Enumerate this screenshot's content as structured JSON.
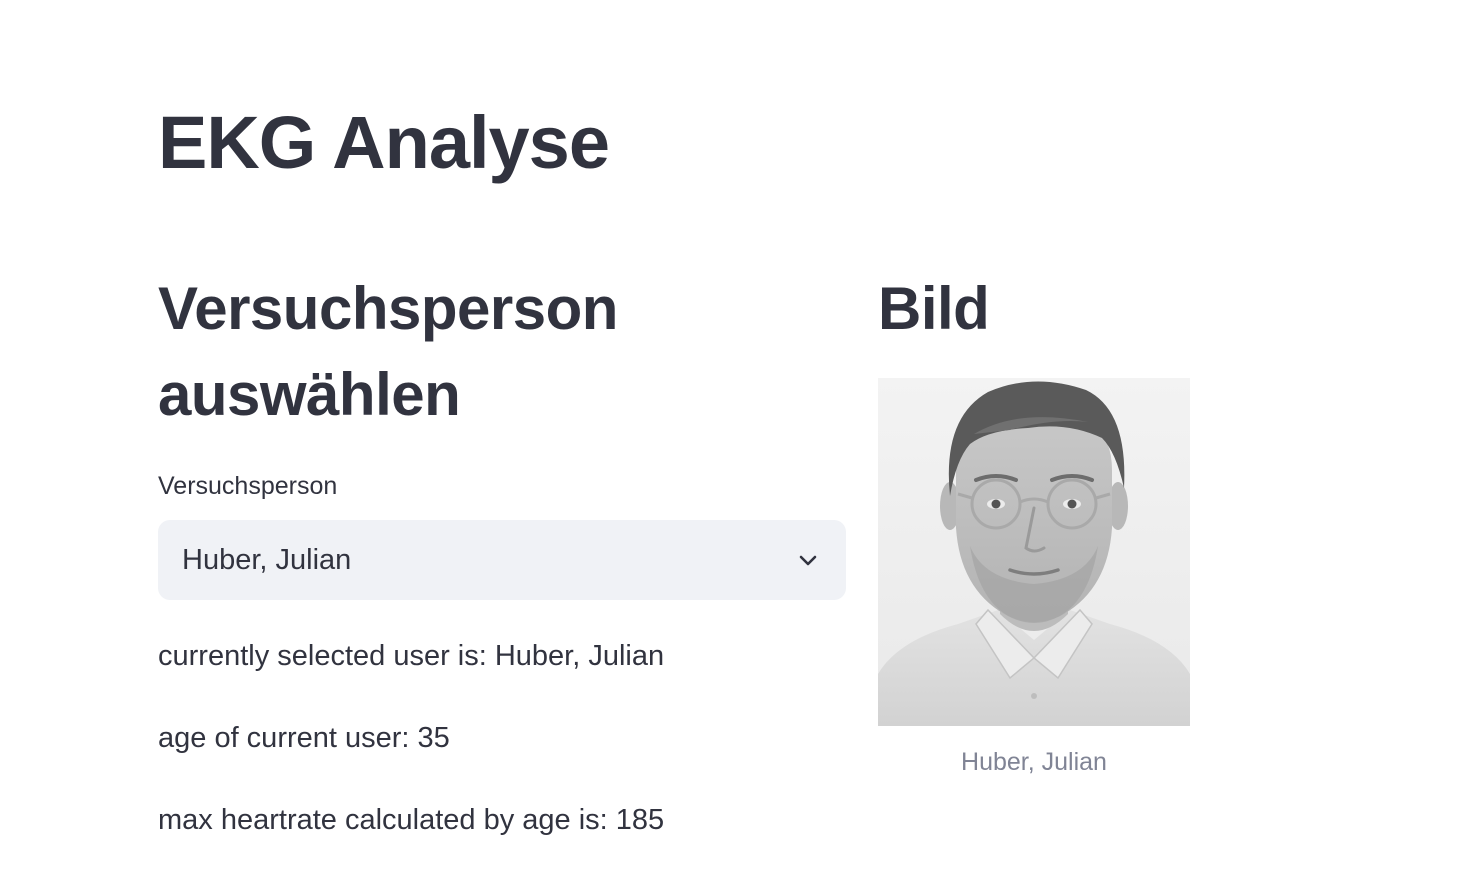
{
  "page": {
    "title": "EKG Analyse"
  },
  "left_column": {
    "heading": "Versuchsperson auswählen",
    "select": {
      "label": "Versuchsperson",
      "value": "Huber, Julian",
      "icon": "chevron-down-icon"
    },
    "info": {
      "selected_user": "currently selected user is: Huber, Julian",
      "age": "age of current user: 35",
      "max_heartrate": "max heartrate calculated by age is: 185"
    }
  },
  "right_column": {
    "heading": "Bild",
    "image": {
      "caption": "Huber, Julian"
    }
  }
}
